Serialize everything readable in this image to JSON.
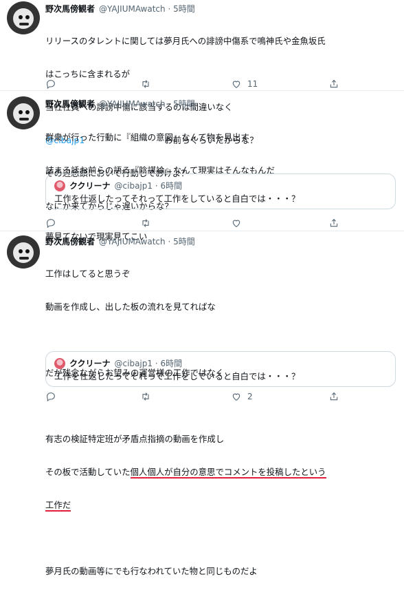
{
  "tweets": [
    {
      "name": "野次馬傍観者",
      "handle": "@YAJIUMAwatch · 5時間",
      "lines": [
        "リリースのタレントに関しては夢月氏への誹謗中傷系で鳴神氏や金魚坂氏",
        "はこっちに含まれるが",
        "当社社員への誹謗中傷に該当するのは間違いなく",
        "お前らくらいだからな？",
        "その辺念頭において行動しておけよ？",
        "なにか来てからじゃ遅いからな？"
      ],
      "mention": "@cibajp1",
      "reply_count": "",
      "retweet_count": "",
      "like_count": "11"
    },
    {
      "name": "野次馬傍観者",
      "handle": "@YAJIUMAwatch · 5時間",
      "lines": [
        "群衆が行った行動に『組織の意図』なんて物を見出す",
        "詰まる話お前らの語る『陰謀論』なんて現実はそんなもんだ",
        "",
        "夢見てないで現実見てこい"
      ],
      "quote": {
        "name": "ククリーナ",
        "handle": "@cibajp1 · 6時間",
        "text": "工作を仕返したってそれって工作をしていると自白では・・・？"
      },
      "like_count": ""
    },
    {
      "name": "野次馬傍観者",
      "handle": "@YAJIUMAwatch · 5時間",
      "lines": [
        "工作はしてると思うぞ",
        "動画を作成し、出した板の流れを見てればな",
        "",
        "だが残念ながらお望みの運営様の工作ではなく",
        "",
        "有志の検証特定班が矛盾点指摘の動画を作成し",
        "その板で活動していた",
        "個人個人が自分の意思でコメントを投稿したという",
        "工作だ",
        "",
        "夢月氏の動画等にでも行なわれていた物と同じものだよ"
      ],
      "quote": {
        "name": "ククリーナ",
        "handle": "@cibajp1 · 6時間",
        "text": "工作を仕返したってそれって工作をしていると自白では・・・？"
      },
      "like_count": "2"
    }
  ]
}
